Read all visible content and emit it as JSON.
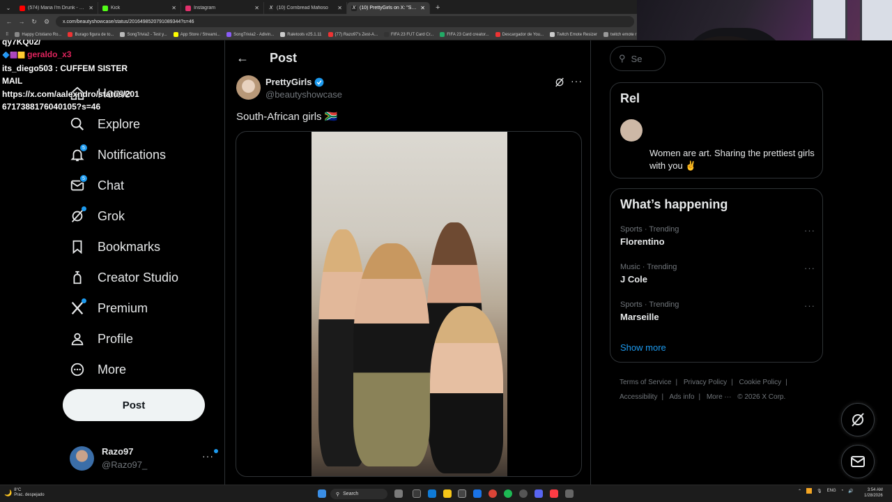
{
  "browser": {
    "tabs": [
      {
        "title": "(574) Maria I'm Drunk - YouTub",
        "color": "#ff0000"
      },
      {
        "title": "Kick",
        "color": "#53fc18"
      },
      {
        "title": "Instagram",
        "color": "#e1306c"
      },
      {
        "title": "(10) Cornbread Mafioso",
        "color": "#ffffff"
      },
      {
        "title": "(10) PrettyGirls on X: \"South",
        "color": "#ffffff"
      }
    ],
    "url": "x.com/beautyshowcase/status/2016498520791089344?s=46",
    "bookmarks": [
      "Happy Cristiano Ro...",
      "Burago figura de to...",
      "SongTrivia2 - Test y...",
      "App Store / Streami...",
      "SongTrivia2 - Adivin...",
      "Raletools v25.1.11",
      "(77) Razo97's Zest-A...",
      "FIFA 23 FUT Card Cr...",
      "FIFA 23 Card creator...",
      "Descargador de You...",
      "Twitch Emote Resizer",
      "twitch emote r"
    ]
  },
  "chat_overlay": {
    "line0": "qy7KQ02/",
    "line1_user": "geraldo_x3",
    "line2_user": "its_diego503",
    "line2_text": ": CUFFEM SISTER",
    "line3": "MAIL",
    "line4": "https://x.com/aalexndro/status/201",
    "line5": "6717388176040105?s=46"
  },
  "nav": {
    "items": [
      {
        "label": "Home",
        "icon": "home-icon"
      },
      {
        "label": "Explore",
        "icon": "search-icon"
      },
      {
        "label": "Notifications",
        "icon": "bell-icon",
        "badge": "5"
      },
      {
        "label": "Chat",
        "icon": "mail-icon",
        "badge": "5"
      },
      {
        "label": "Grok",
        "icon": "grok-icon"
      },
      {
        "label": "Bookmarks",
        "icon": "bookmark-icon"
      },
      {
        "label": "Creator Studio",
        "icon": "creator-studio-icon"
      },
      {
        "label": "Premium",
        "icon": "x-icon"
      },
      {
        "label": "Profile",
        "icon": "person-icon"
      },
      {
        "label": "More",
        "icon": "more-circle-icon"
      }
    ],
    "post_button": "Post",
    "account": {
      "name": "Razo97",
      "handle": "@Razo97_"
    }
  },
  "post": {
    "header_title": "Post",
    "author_name": "PrettyGirls",
    "author_handle": "@beautyshowcase",
    "text": "South-African girls 🇿🇦"
  },
  "right": {
    "search_placeholder": "Se",
    "relevant_title": "Rel",
    "relevant_bio": "Women are art. Sharing the prettiest girls with you ✌️",
    "happening_title": "What’s happening",
    "trends": [
      {
        "meta": "Sports · Trending",
        "name": "Florentino"
      },
      {
        "meta": "Music · Trending",
        "name": "J Cole"
      },
      {
        "meta": "Sports · Trending",
        "name": "Marseille"
      }
    ],
    "show_more": "Show more",
    "footer_row1": [
      "Terms of Service",
      "|",
      "Privacy Policy",
      "|",
      "Cookie Policy",
      "|"
    ],
    "footer_row2": [
      "Accessibility",
      "|",
      "Ads info",
      "|",
      "More ···",
      "© 2026 X Corp."
    ]
  },
  "taskbar": {
    "weather_temp": "8°C",
    "weather_text": "Prac. despejado",
    "search": "Search",
    "lang": "ENG",
    "time": "3:54 AM",
    "date": "1/28/2026"
  },
  "colors": {
    "accent": "#1d9bf0",
    "bg": "#000000",
    "border": "#2f3336",
    "muted": "#71767b"
  }
}
